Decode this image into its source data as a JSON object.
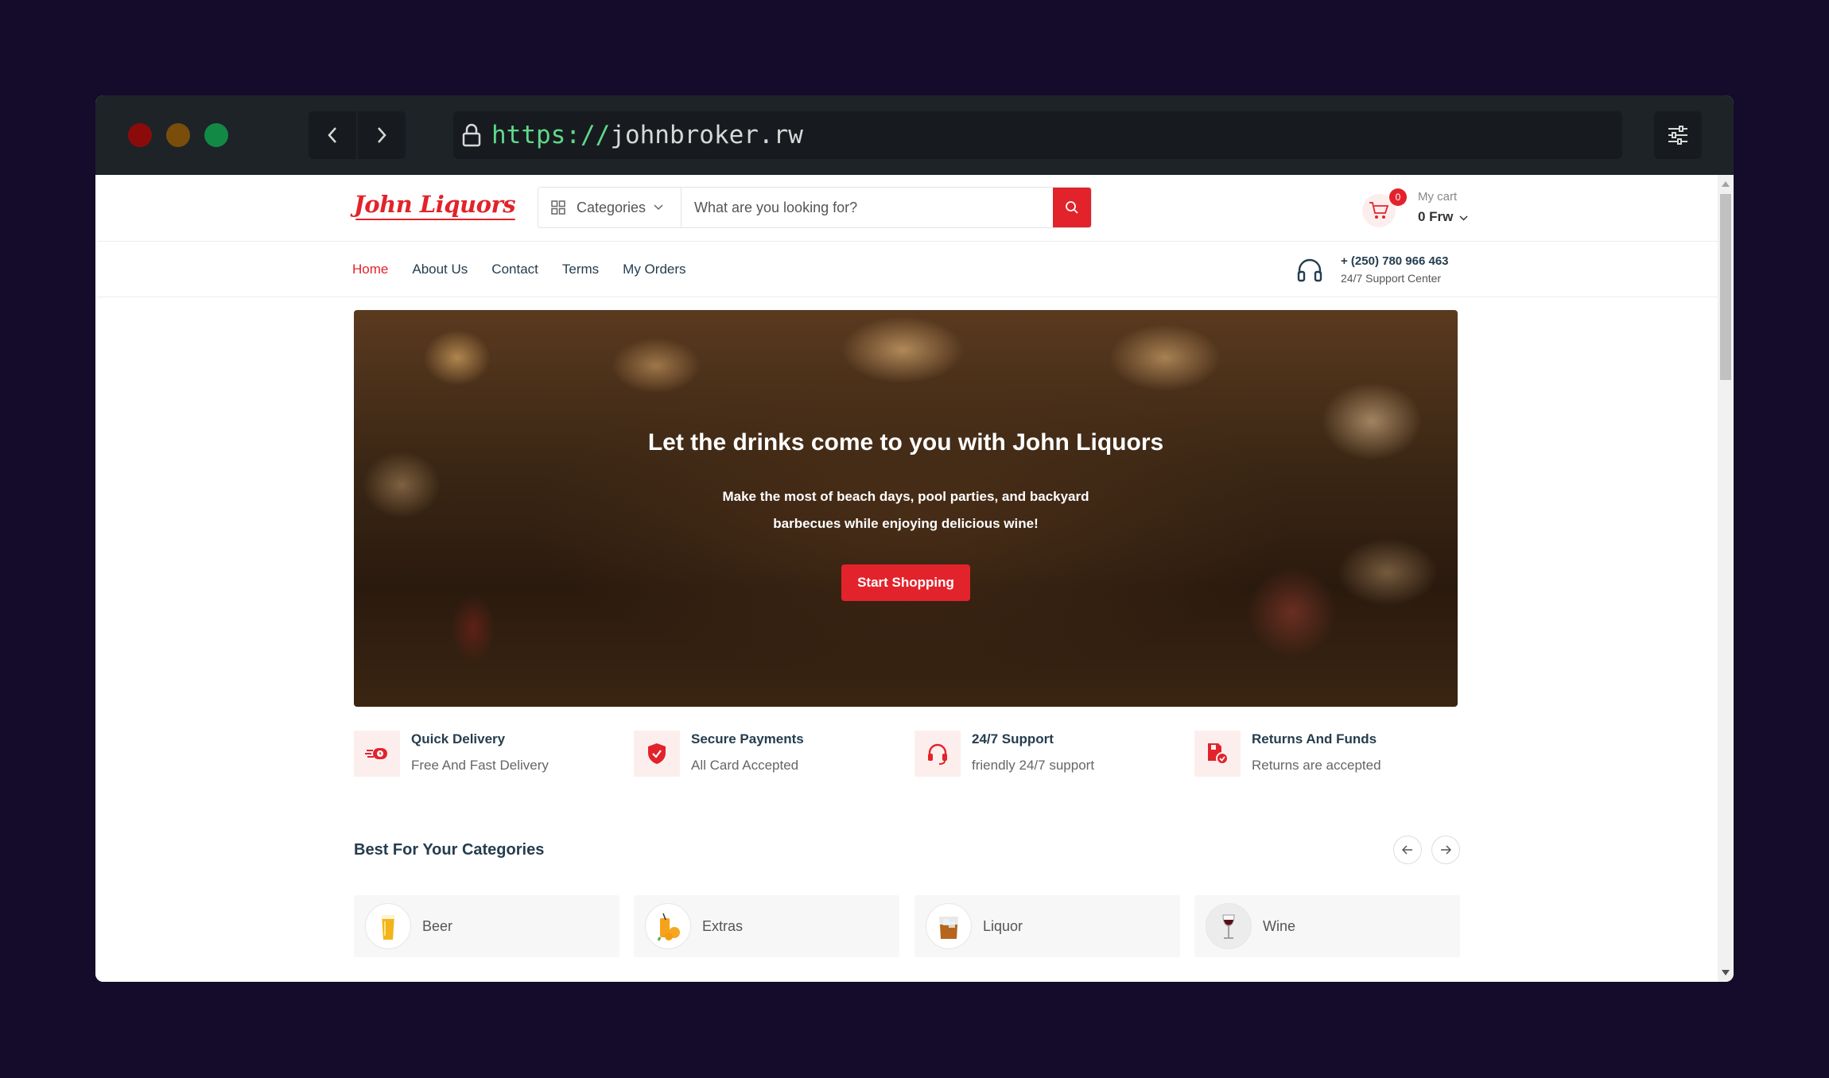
{
  "browser": {
    "url_scheme": "https://",
    "url_host": "johnbroker.rw"
  },
  "header": {
    "logo_text": "John Liquors",
    "categories_label": "Categories",
    "search_placeholder": "What are you looking for?",
    "cart": {
      "badge_count": "0",
      "label": "My cart",
      "total": "0 Frw"
    }
  },
  "nav": {
    "links": [
      "Home",
      "About Us",
      "Contact",
      "Terms",
      "My Orders"
    ],
    "active": "Home",
    "support_phone": "+ (250) 780 966 463",
    "support_label": "24/7 Support Center"
  },
  "hero": {
    "title": "Let the drinks come to you with John Liquors",
    "subtitle": "Make the most of beach days, pool parties, and backyard barbecues while enjoying delicious wine!",
    "button": "Start Shopping"
  },
  "features": [
    {
      "title": "Quick Delivery",
      "subtitle": "Free And Fast Delivery",
      "icon": "delivery-icon"
    },
    {
      "title": "Secure Payments",
      "subtitle": "All Card Accepted",
      "icon": "shield-icon"
    },
    {
      "title": "24/7 Support",
      "subtitle": "friendly 24/7 support",
      "icon": "headset-icon"
    },
    {
      "title": "Returns And Funds",
      "subtitle": "Returns are accepted",
      "icon": "returns-icon"
    }
  ],
  "categories_section": {
    "title": "Best For Your Categories",
    "items": [
      {
        "name": "Beer",
        "icon": "beer-icon"
      },
      {
        "name": "Extras",
        "icon": "juice-icon"
      },
      {
        "name": "Liquor",
        "icon": "whiskey-icon"
      },
      {
        "name": "Wine",
        "icon": "wine-glass-icon"
      }
    ]
  },
  "colors": {
    "brand": "#e2232b",
    "text": "#253d4e",
    "desktop_bg": "#140c2a",
    "chrome_bg": "#1e2328"
  }
}
